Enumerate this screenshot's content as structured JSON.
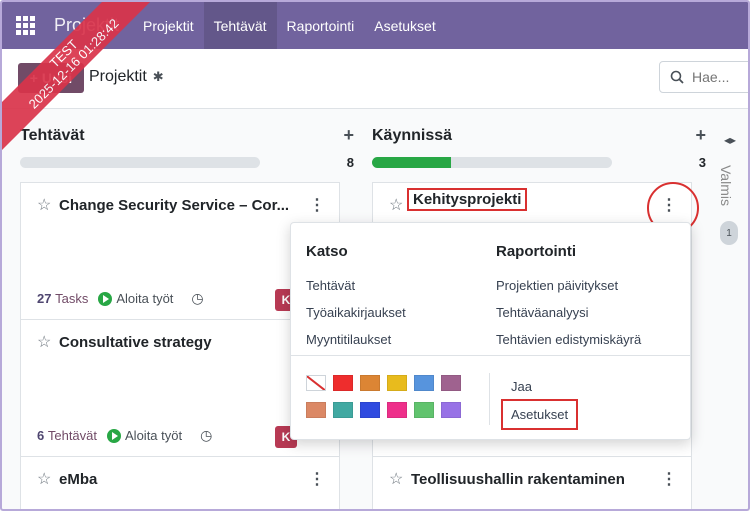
{
  "navbar": {
    "brand": "Projektit",
    "items": [
      "Projektit",
      "Tehtävät",
      "Raportointi",
      "Asetukset"
    ],
    "active_index": 1
  },
  "ribbon": {
    "line1": "TEST",
    "line2": "2025-12-16 01:28:42"
  },
  "control": {
    "new_label": "+ Uusi",
    "title": "Projektit",
    "search_placeholder": "Hae..."
  },
  "columns": [
    {
      "title": "Tehtävät",
      "count": "8",
      "progress": 0,
      "cards": [
        {
          "title": "Change Security Service – Cor...",
          "count": "27",
          "count_label": "Tasks",
          "start_label": "Aloita työt",
          "avatar": "K"
        },
        {
          "title": "Consultative strategy",
          "count": "6",
          "count_label": "Tehtävät",
          "start_label": "Aloita työt",
          "avatar": "K"
        },
        {
          "title": "eMba"
        }
      ]
    },
    {
      "title": "Käynnissä",
      "count": "3",
      "progress": 0.33,
      "cards": [
        {
          "title": "Kehitysprojekti"
        },
        {
          "title": "Teollisuushallin rakentaminen"
        }
      ]
    }
  ],
  "folded_column": {
    "title": "Valmis",
    "count": "1"
  },
  "dropdown": {
    "view_heading": "Katso",
    "view_items": [
      "Tehtävät",
      "Työaikakirjaukset",
      "Myyntitilaukset"
    ],
    "report_heading": "Raportointi",
    "report_items": [
      "Projektien päivitykset",
      "Tehtäväanalyysi",
      "Tehtävien edistymiskäyrä"
    ],
    "actions": [
      "Jaa",
      "Asetukset"
    ],
    "colors": [
      "#ffffff",
      "#ee2d2d",
      "#dc8534",
      "#e8bb1d",
      "#5794dd",
      "#9f628f",
      "#db8865",
      "#41a9a2",
      "#304be0",
      "#ee2f8a",
      "#61c36e",
      "#9872e6"
    ]
  }
}
